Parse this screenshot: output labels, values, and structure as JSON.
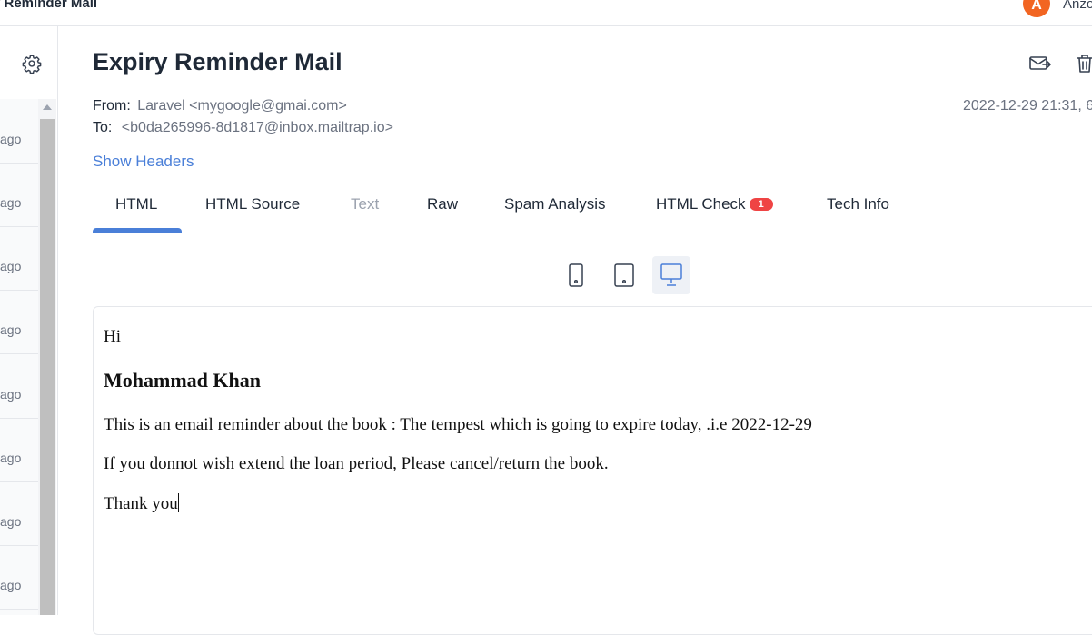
{
  "topbar": {
    "title": "y Reminder Mail",
    "avatar_letter": "A",
    "user_name": "Anzo"
  },
  "sidebar": {
    "settings_icon": "gear-icon",
    "items": [
      {
        "time": "ago"
      },
      {
        "time": "ago"
      },
      {
        "time": "ago"
      },
      {
        "time": "ago"
      },
      {
        "time": "ago"
      },
      {
        "time": "ago"
      },
      {
        "time": "ago"
      },
      {
        "time": "ago"
      }
    ]
  },
  "message": {
    "subject": "Expiry Reminder Mail",
    "from_label": "From:",
    "from_value": "Laravel <mygoogle@gmai.com>",
    "to_label": "To:",
    "to_value": "<b0da265996-8d1817@inbox.mailtrap.io>",
    "date": "2022-12-29 21:31, 6",
    "show_headers": "Show Headers",
    "actions": {
      "forward_icon": "forward-mail-icon",
      "delete_icon": "trash-icon"
    }
  },
  "tabs": [
    {
      "label": "HTML",
      "active": true
    },
    {
      "label": "HTML Source"
    },
    {
      "label": "Text",
      "disabled": true
    },
    {
      "label": "Raw"
    },
    {
      "label": "Spam Analysis"
    },
    {
      "label": "HTML Check",
      "badge": "1"
    },
    {
      "label": "Tech Info"
    }
  ],
  "device_toggle": {
    "options": [
      {
        "icon": "mobile-icon"
      },
      {
        "icon": "tablet-icon"
      },
      {
        "icon": "desktop-icon",
        "selected": true
      }
    ]
  },
  "preview": {
    "greeting": "Hi",
    "name": "Mohammad Khan",
    "line1": "This is an email reminder about the book : The tempest which is going to expire today, .i.e 2022-12-29",
    "line2": "If you donnot wish extend the loan period, Please cancel/return the book.",
    "closing": "Thank you"
  },
  "colors": {
    "accent": "#4a7fd8",
    "avatar": "#f26522",
    "badge": "#ef4444"
  }
}
